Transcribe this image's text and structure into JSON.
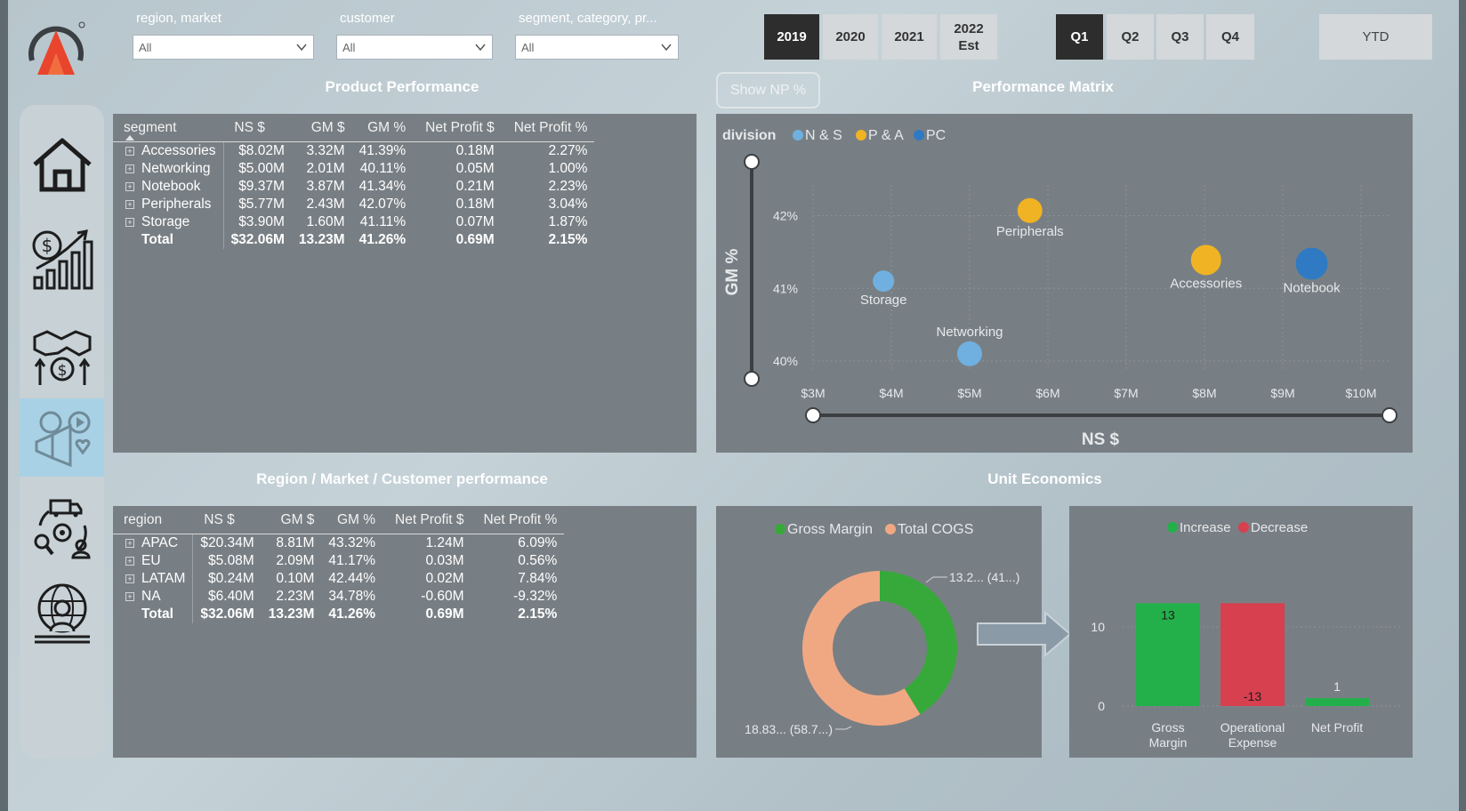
{
  "slicers": [
    {
      "label": "region, market",
      "value": "All"
    },
    {
      "label": "customer",
      "value": "All"
    },
    {
      "label": "segment, category, pr...",
      "value": "All"
    }
  ],
  "years": [
    "2019",
    "2020",
    "2021",
    "2022 Est"
  ],
  "selected_year": "2019",
  "quarters": [
    "Q1",
    "Q2",
    "Q3",
    "Q4"
  ],
  "selected_quarter": "Q1",
  "ytd_label": "YTD",
  "show_np_label": "Show NP %",
  "nav": [
    {
      "icon": "home-icon"
    },
    {
      "icon": "finance-growth-icon"
    },
    {
      "icon": "sales-handshake-icon"
    },
    {
      "icon": "marketing-megaphone-icon",
      "active": true
    },
    {
      "icon": "supply-chain-icon"
    },
    {
      "icon": "executive-globe-icon"
    }
  ],
  "product": {
    "title": "Product Performance",
    "headers": [
      "segment",
      "NS $",
      "GM $",
      "GM %",
      "Net Profit $",
      "Net Profit %"
    ],
    "rows": [
      [
        "Accessories",
        "$8.02M",
        "3.32M",
        "41.39%",
        "0.18M",
        "2.27%"
      ],
      [
        "Networking",
        "$5.00M",
        "2.01M",
        "40.11%",
        "0.05M",
        "1.00%"
      ],
      [
        "Notebook",
        "$9.37M",
        "3.87M",
        "41.34%",
        "0.21M",
        "2.23%"
      ],
      [
        "Peripherals",
        "$5.77M",
        "2.43M",
        "42.07%",
        "0.18M",
        "3.04%"
      ],
      [
        "Storage",
        "$3.90M",
        "1.60M",
        "41.11%",
        "0.07M",
        "1.87%"
      ]
    ],
    "total": [
      "Total",
      "$32.06M",
      "13.23M",
      "41.26%",
      "0.69M",
      "2.15%"
    ]
  },
  "region": {
    "title": "Region / Market / Customer performance",
    "headers": [
      "region",
      "NS $",
      "GM $",
      "GM %",
      "Net Profit $",
      "Net Profit %"
    ],
    "rows": [
      [
        "APAC",
        "$20.34M",
        "8.81M",
        "43.32%",
        "1.24M",
        "6.09%"
      ],
      [
        "EU",
        "$5.08M",
        "2.09M",
        "41.17%",
        "0.03M",
        "0.56%"
      ],
      [
        "LATAM",
        "$0.24M",
        "0.10M",
        "42.44%",
        "0.02M",
        "7.84%"
      ],
      [
        "NA",
        "$6.40M",
        "2.23M",
        "34.78%",
        "-0.60M",
        "-9.32%"
      ]
    ],
    "total": [
      "Total",
      "$32.06M",
      "13.23M",
      "41.26%",
      "0.69M",
      "2.15%"
    ]
  },
  "unit_title": "Unit Economics",
  "chart_data": [
    {
      "type": "scatter",
      "title": "Performance Matrix",
      "xlabel": "NS $",
      "ylabel": "GM %",
      "legend_title": "division",
      "xlim": [
        3,
        10
      ],
      "ylim": [
        40,
        42.3
      ],
      "x_ticks": [
        "$3M",
        "$4M",
        "$5M",
        "$6M",
        "$7M",
        "$8M",
        "$9M",
        "$10M"
      ],
      "y_ticks": [
        "40%",
        "41%",
        "42%"
      ],
      "series": [
        {
          "name": "N & S",
          "color": "#6fb0e0",
          "points": [
            {
              "label": "Storage",
              "x": 3.9,
              "y": 41.1
            },
            {
              "label": "Networking",
              "x": 5.0,
              "y": 40.1
            }
          ]
        },
        {
          "name": "P & A",
          "color": "#f0b323",
          "points": [
            {
              "label": "Peripherals",
              "x": 5.77,
              "y": 42.07
            },
            {
              "label": "Accessories",
              "x": 8.02,
              "y": 41.39
            }
          ]
        },
        {
          "name": "PC",
          "color": "#2f7ac2",
          "points": [
            {
              "label": "Notebook",
              "x": 9.37,
              "y": 41.34
            }
          ]
        }
      ]
    },
    {
      "type": "pie",
      "legend": [
        {
          "name": "Gross Margin",
          "color": "#37a93a"
        },
        {
          "name": "Total COGS",
          "color": "#f0a883"
        }
      ],
      "values": [
        13.23,
        18.83
      ],
      "labels": [
        "13.2... (41...)",
        "18.83... (58.7...)"
      ]
    },
    {
      "type": "bar",
      "legend": [
        {
          "name": "Increase",
          "color": "#23b04a"
        },
        {
          "name": "Decrease",
          "color": "#d6404f"
        }
      ],
      "categories": [
        "Gross Margin",
        "Operational Expense",
        "Net Profit"
      ],
      "values": [
        13,
        -13,
        1
      ],
      "data_labels": [
        "13",
        "-13",
        "1"
      ],
      "y_ticks": [
        "0",
        "10"
      ]
    }
  ]
}
